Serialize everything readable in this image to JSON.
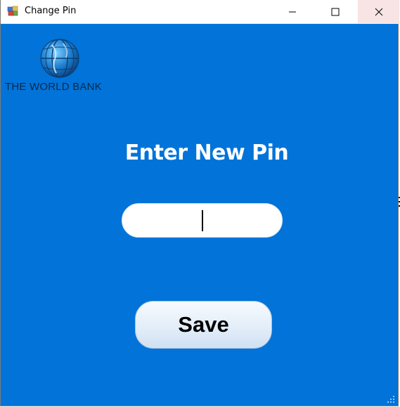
{
  "window": {
    "title": "Change Pin",
    "controls": {
      "minimize_icon": "minimize-icon",
      "maximize_icon": "maximize-icon",
      "close_icon": "close-icon"
    }
  },
  "logo": {
    "text": "THE WORLD BANK",
    "icon": "globe-icon"
  },
  "form": {
    "heading": "Enter New Pin",
    "pin_value": "",
    "pin_placeholder": "",
    "save_label": "Save"
  },
  "colors": {
    "background": "#0173d9",
    "heading_text": "#ffffff",
    "close_hover": "#f8e4e4"
  }
}
